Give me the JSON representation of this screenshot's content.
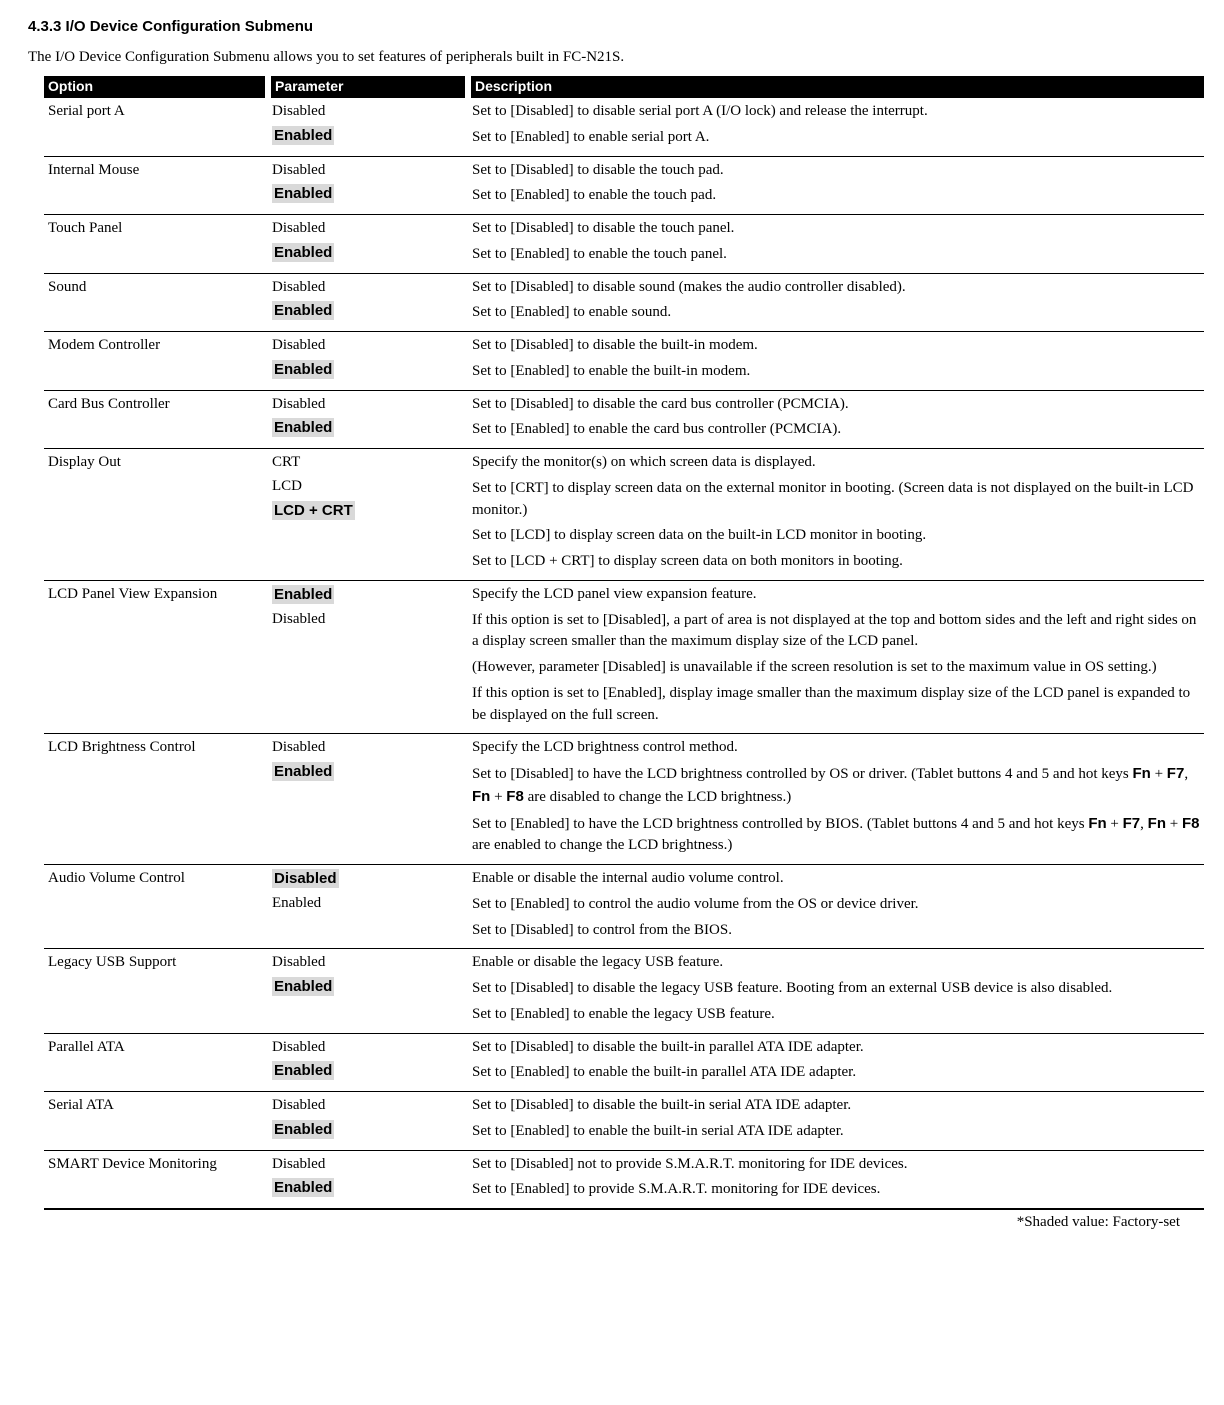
{
  "heading": "4.3.3  I/O Device Configuration Submenu",
  "intro": "The I/O Device Configuration Submenu allows you to set features of peripherals built in FC-N21S.",
  "columns": {
    "option": "Option",
    "parameter": "Parameter",
    "description": "Description"
  },
  "footnote": "*Shaded value: Factory-set",
  "rows": [
    {
      "option": "Serial port A",
      "params": [
        {
          "text": "Disabled",
          "shaded": false
        },
        {
          "text": "Enabled",
          "shaded": true
        }
      ],
      "desc": [
        "Set to [Disabled] to disable serial port A (I/O lock) and release the interrupt.",
        "Set to [Enabled] to enable serial port A."
      ]
    },
    {
      "option": "Internal Mouse",
      "params": [
        {
          "text": "Disabled",
          "shaded": false
        },
        {
          "text": "Enabled",
          "shaded": true
        }
      ],
      "desc": [
        "Set to [Disabled] to disable the touch pad.",
        "Set to [Enabled] to enable the touch pad."
      ]
    },
    {
      "option": "Touch Panel",
      "params": [
        {
          "text": "Disabled",
          "shaded": false
        },
        {
          "text": "Enabled",
          "shaded": true
        }
      ],
      "desc": [
        "Set to [Disabled] to disable the touch panel.",
        "Set to [Enabled] to enable the touch panel."
      ]
    },
    {
      "option": "Sound",
      "params": [
        {
          "text": "Disabled",
          "shaded": false
        },
        {
          "text": "Enabled",
          "shaded": true
        }
      ],
      "desc": [
        "Set to [Disabled] to disable sound (makes the audio controller disabled).",
        "Set to [Enabled] to enable sound."
      ]
    },
    {
      "option": "Modem Controller",
      "params": [
        {
          "text": "Disabled",
          "shaded": false
        },
        {
          "text": "Enabled",
          "shaded": true
        }
      ],
      "desc": [
        "Set to [Disabled] to disable the built-in modem.",
        "Set to [Enabled] to enable the built-in modem."
      ]
    },
    {
      "option": "Card Bus Controller",
      "params": [
        {
          "text": "Disabled",
          "shaded": false
        },
        {
          "text": "Enabled",
          "shaded": true
        }
      ],
      "desc": [
        "Set to [Disabled] to disable the card bus controller (PCMCIA).",
        "Set to [Enabled] to enable the card bus controller (PCMCIA)."
      ]
    },
    {
      "option": "Display Out",
      "params": [
        {
          "text": "CRT",
          "shaded": false
        },
        {
          "text": "LCD",
          "shaded": false
        },
        {
          "text": "LCD + CRT",
          "shaded": true
        }
      ],
      "desc": [
        "Specify the monitor(s) on which screen data is displayed.",
        "Set to [CRT] to display screen data on the external monitor in booting. (Screen data is not displayed on the built-in LCD monitor.)",
        "Set to [LCD] to display screen data on the built-in LCD monitor in booting.",
        "Set to [LCD + CRT] to display screen data on both monitors in booting."
      ]
    },
    {
      "option": "LCD Panel View Expansion",
      "params": [
        {
          "text": "Enabled",
          "shaded": true
        },
        {
          "text": "Disabled",
          "shaded": false
        }
      ],
      "desc": [
        "Specify the LCD panel view expansion feature.",
        "If this option is set to [Disabled], a part of area is not displayed at the top and bottom sides and the left and right sides on a display screen smaller than the maximum display size of the LCD panel.",
        "(However, parameter [Disabled] is unavailable if the screen resolution is set to the maximum value in OS setting.)",
        "If this option is set to [Enabled], display image smaller than the maximum display size of the LCD panel is expanded to be displayed on the full screen."
      ]
    },
    {
      "option": "LCD Brightness Control",
      "params": [
        {
          "text": "Disabled",
          "shaded": false
        },
        {
          "text": "Enabled",
          "shaded": true
        }
      ],
      "desc_html": [
        "Specify the LCD brightness control method.",
        "Set to [Disabled] to have the LCD brightness controlled by OS or driver. (Tablet buttons 4 and 5 and hot keys <span class=\"bold-sans\">Fn</span> + <span class=\"bold-sans\">F7</span>, <span class=\"bold-sans\">Fn</span> + <span class=\"bold-sans\">F8</span> are disabled to change the LCD brightness.)",
        "Set to [Enabled] to have the LCD brightness controlled by BIOS. (Tablet buttons 4 and 5 and hot keys <span class=\"bold-sans\">Fn</span> + <span class=\"bold-sans\">F7</span>, <span class=\"bold-sans\">Fn</span> + <span class=\"bold-sans\">F8</span> are enabled to change the LCD brightness.)"
      ]
    },
    {
      "option": "Audio Volume Control",
      "params": [
        {
          "text": "Disabled",
          "shaded": true
        },
        {
          "text": "Enabled",
          "shaded": false
        }
      ],
      "desc": [
        "Enable or disable the internal audio volume control.",
        "Set to [Enabled] to control the audio volume from the OS or device driver.",
        "Set to [Disabled] to control from the BIOS."
      ]
    },
    {
      "option": "Legacy USB Support",
      "params": [
        {
          "text": "Disabled",
          "shaded": false
        },
        {
          "text": "Enabled",
          "shaded": true
        }
      ],
      "desc": [
        "Enable or disable the legacy USB feature.",
        "Set to [Disabled] to disable the legacy USB feature. Booting from an external USB device is also disabled.",
        "Set to [Enabled] to enable the legacy USB feature."
      ]
    },
    {
      "option": "Parallel ATA",
      "params": [
        {
          "text": "Disabled",
          "shaded": false
        },
        {
          "text": "Enabled",
          "shaded": true
        }
      ],
      "desc": [
        "Set to [Disabled] to disable the built-in parallel ATA IDE adapter.",
        "Set to [Enabled] to enable the built-in parallel ATA IDE adapter."
      ]
    },
    {
      "option": "Serial ATA",
      "params": [
        {
          "text": "Disabled",
          "shaded": false
        },
        {
          "text": "Enabled",
          "shaded": true
        }
      ],
      "desc": [
        "Set to [Disabled] to disable the built-in serial ATA IDE adapter.",
        "Set to [Enabled] to enable the built-in serial ATA IDE adapter."
      ]
    },
    {
      "option": "SMART Device Monitoring",
      "params": [
        {
          "text": "Disabled",
          "shaded": false
        },
        {
          "text": "Enabled",
          "shaded": true
        }
      ],
      "desc": [
        "Set to [Disabled] not to provide S.M.A.R.T. monitoring for IDE devices.",
        "Set to [Enabled] to provide S.M.A.R.T. monitoring for IDE devices."
      ]
    }
  ]
}
